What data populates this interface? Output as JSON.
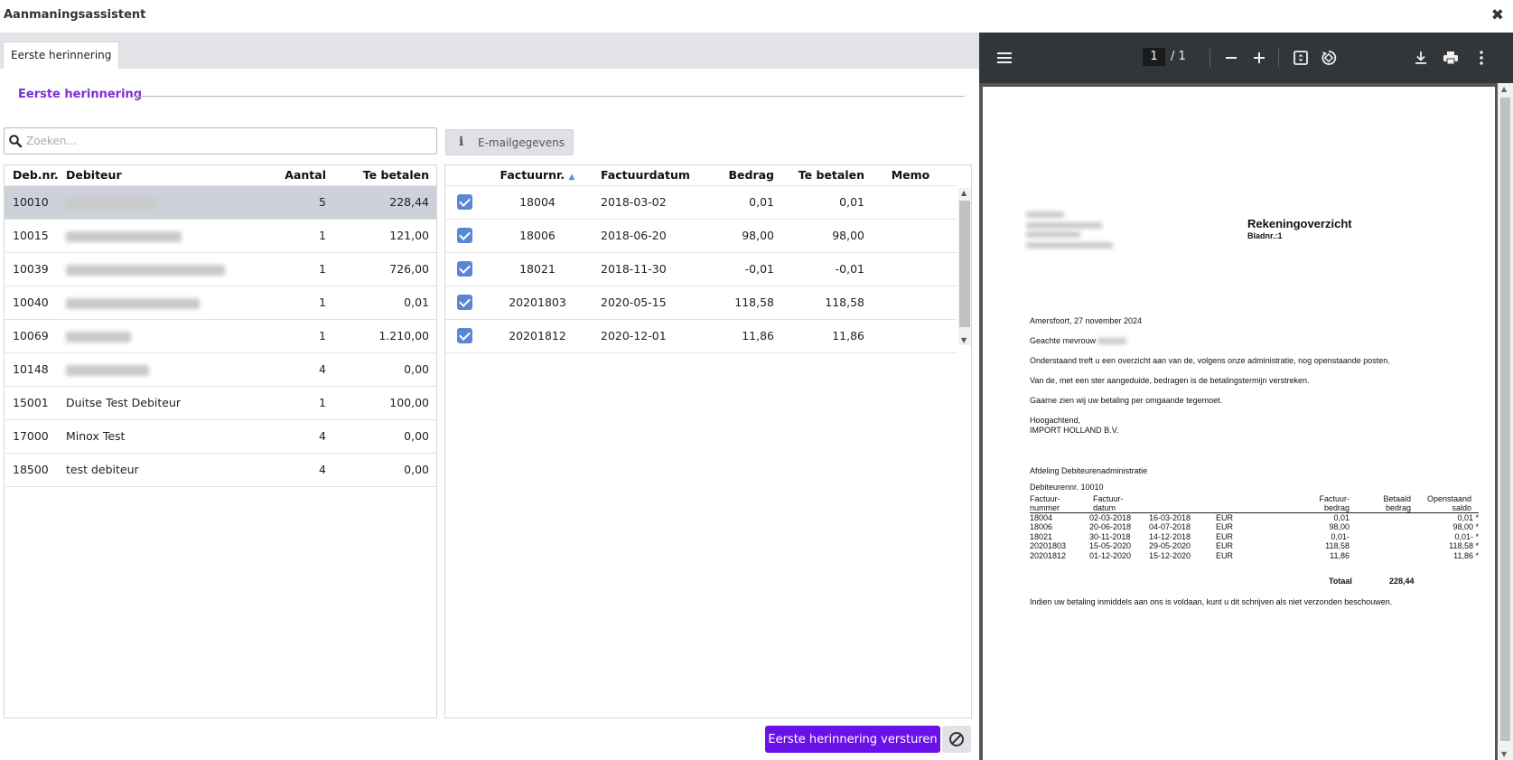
{
  "window": {
    "title": "Aanmaningsassistent"
  },
  "tabs": [
    {
      "label": "Eerste herinnering"
    }
  ],
  "section": {
    "title": "Eerste herinnering"
  },
  "search": {
    "placeholder": "Zoeken..."
  },
  "email_button": {
    "label": "E-mailgegevens"
  },
  "debtors": {
    "headers": {
      "nr": "Deb.nr.",
      "name": "Debiteur",
      "count": "Aantal",
      "due": "Te betalen"
    },
    "rows": [
      {
        "nr": "10010",
        "name": "",
        "count": "5",
        "due": "228,44",
        "selected": true
      },
      {
        "nr": "10015",
        "name": "",
        "count": "1",
        "due": "121,00"
      },
      {
        "nr": "10039",
        "name": "",
        "count": "1",
        "due": "726,00"
      },
      {
        "nr": "10040",
        "name": "",
        "count": "1",
        "due": "0,01"
      },
      {
        "nr": "10069",
        "name": "",
        "count": "1",
        "due": "1.210,00"
      },
      {
        "nr": "10148",
        "name": "",
        "count": "4",
        "due": "0,00"
      },
      {
        "nr": "15001",
        "name": "Duitse Test Debiteur",
        "count": "1",
        "due": "100,00"
      },
      {
        "nr": "17000",
        "name": "Minox Test",
        "count": "4",
        "due": "0,00"
      },
      {
        "nr": "18500",
        "name": "test debiteur",
        "count": "4",
        "due": "0,00"
      }
    ]
  },
  "invoices": {
    "headers": {
      "nr": "Factuurnr.",
      "date": "Factuurdatum",
      "amount": "Bedrag",
      "due": "Te betalen",
      "memo": "Memo"
    },
    "rows": [
      {
        "checked": true,
        "nr": "18004",
        "date": "2018-03-02",
        "amount": "0,01",
        "due": "0,01",
        "memo": ""
      },
      {
        "checked": true,
        "nr": "18006",
        "date": "2018-06-20",
        "amount": "98,00",
        "due": "98,00",
        "memo": ""
      },
      {
        "checked": true,
        "nr": "18021",
        "date": "2018-11-30",
        "amount": "-0,01",
        "due": "-0,01",
        "memo": ""
      },
      {
        "checked": true,
        "nr": "20201803",
        "date": "2020-05-15",
        "amount": "118,58",
        "due": "118,58",
        "memo": ""
      },
      {
        "checked": true,
        "nr": "20201812",
        "date": "2020-12-01",
        "amount": "11,86",
        "due": "11,86",
        "memo": ""
      }
    ]
  },
  "send_button": {
    "label": "Eerste herinnering versturen"
  },
  "pdf_viewer": {
    "page_current": "1",
    "page_total": "/ 1",
    "document": {
      "title": "Rekeningoverzicht",
      "bladnr": "Bladnr.:1",
      "place_date": "Amersfoort, 27 november 2024",
      "salutation": "Geachte mevrouw",
      "p1": "Onderstaand treft u een overzicht aan van de, volgens onze administratie, nog openstaande posten.",
      "p2": "Van de, met een ster aangeduide, bedragen is de betalingstermijn verstreken.",
      "p3": "Gaarne zien wij uw betaling per omgaande tegemoet.",
      "closing": "Hoogachtend,",
      "company": "IMPORT HOLLAND B.V.",
      "department": "Afdeling Debiteurenadministratie",
      "debtor_nr": "Debiteurennr. 10010",
      "table_headers": {
        "h1a": "Factuur-",
        "h1b": "nummer",
        "h2a": "Factuur-",
        "h2b": "datum",
        "h3a": "Factuur-",
        "h3b": "bedrag",
        "h4a": "Betaald",
        "h4b": "bedrag",
        "h5a": "Openstaand",
        "h5b": "saldo"
      },
      "rows": [
        {
          "nr": "18004",
          "date": "02-03-2018",
          "due": "16-03-2018",
          "cur": "EUR",
          "amount": "0,01",
          "paid": "",
          "open": "0,01 *"
        },
        {
          "nr": "18006",
          "date": "20-06-2018",
          "due": "04-07-2018",
          "cur": "EUR",
          "amount": "98,00",
          "paid": "",
          "open": "98,00 *"
        },
        {
          "nr": "18021",
          "date": "30-11-2018",
          "due": "14-12-2018",
          "cur": "EUR",
          "amount": "0,01-",
          "paid": "",
          "open": "0,01- *"
        },
        {
          "nr": "20201803",
          "date": "15-05-2020",
          "due": "29-05-2020",
          "cur": "EUR",
          "amount": "118,58",
          "paid": "",
          "open": "118,58 *"
        },
        {
          "nr": "20201812",
          "date": "01-12-2020",
          "due": "15-12-2020",
          "cur": "EUR",
          "amount": "11,86",
          "paid": "",
          "open": "11,86 *"
        }
      ],
      "total_label": "Totaal",
      "total_value": "228,44",
      "footer": "Indien uw betaling inmiddels aan ons is voldaan, kunt u dit schrijven als niet verzonden beschouwen."
    }
  },
  "colors": {
    "accent": "#6a10e8",
    "section_title": "#7a2fd8",
    "selected_row": "#cdd1d9",
    "checkbox": "#5b86d6",
    "pdf_toolbar": "#323639"
  }
}
